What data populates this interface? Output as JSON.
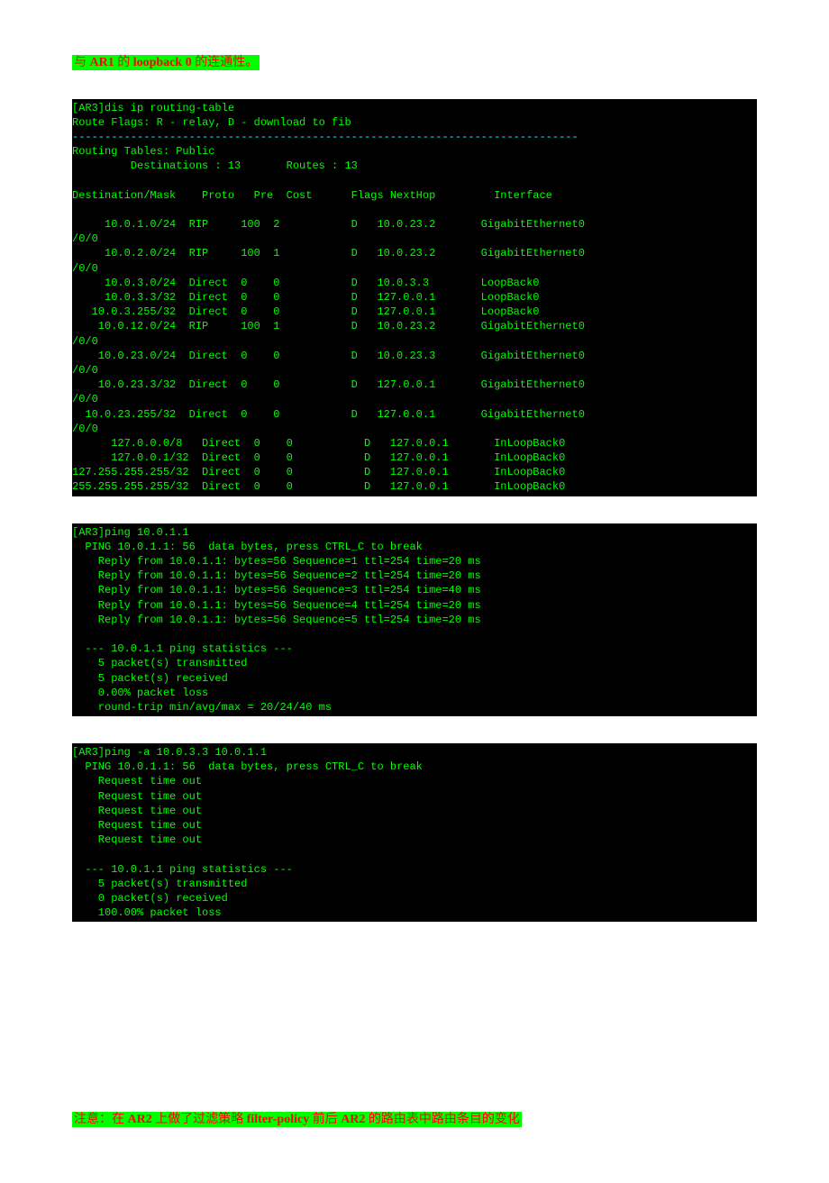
{
  "text1": {
    "pre": "与 ",
    "ar1": "AR1",
    "mid": " 的 ",
    "lb": "loopback 0",
    "post": " 的连通性。"
  },
  "text2": {
    "pre": "注意：在 ",
    "ar2_1": "AR2",
    "mid1": " 上做了过滤策略 ",
    "fp": "filter-policy",
    "mid2": " 前后 ",
    "ar2_2": "AR2",
    "post": " 的路由表中路由条目的变化"
  },
  "term1": {
    "l1": "[AR3]dis ip routing-table",
    "l2": "Route Flags: R - relay, D - download to fib",
    "sep": "------------------------------------------------------------------------------",
    "l3": "Routing Tables: Public",
    "l4": "         Destinations : 13       Routes : 13",
    "hdr": "Destination/Mask    Proto   Pre  Cost      Flags NextHop         Interface",
    "r1a": "     10.0.1.0/24  RIP     100  2           D   10.0.23.2       GigabitEthernet0",
    "slash": "/0/0",
    "r2a": "     10.0.2.0/24  RIP     100  1           D   10.0.23.2       GigabitEthernet0",
    "r3": "     10.0.3.0/24  Direct  0    0           D   10.0.3.3        LoopBack0",
    "r4": "     10.0.3.3/32  Direct  0    0           D   127.0.0.1       LoopBack0",
    "r5": "   10.0.3.255/32  Direct  0    0           D   127.0.0.1       LoopBack0",
    "r6a": "    10.0.12.0/24  RIP     100  1           D   10.0.23.2       GigabitEthernet0",
    "r7a": "    10.0.23.0/24  Direct  0    0           D   10.0.23.3       GigabitEthernet0",
    "r8a": "    10.0.23.3/32  Direct  0    0           D   127.0.0.1       GigabitEthernet0",
    "r9a": "  10.0.23.255/32  Direct  0    0           D   127.0.0.1       GigabitEthernet0",
    "r10": "      127.0.0.0/8   Direct  0    0           D   127.0.0.1       InLoopBack0",
    "r11": "      127.0.0.1/32  Direct  0    0           D   127.0.0.1       InLoopBack0",
    "r12": "127.255.255.255/32  Direct  0    0           D   127.0.0.1       InLoopBack0",
    "r13": "255.255.255.255/32  Direct  0    0           D   127.0.0.1       InLoopBack0"
  },
  "term2": {
    "l1": "[AR3]ping 10.0.1.1",
    "l2": "  PING 10.0.1.1: 56  data bytes, press CTRL_C to break",
    "l3": "    Reply from 10.0.1.1: bytes=56 Sequence=1 ttl=254 time=20 ms",
    "l4": "    Reply from 10.0.1.1: bytes=56 Sequence=2 ttl=254 time=20 ms",
    "l5": "    Reply from 10.0.1.1: bytes=56 Sequence=3 ttl=254 time=40 ms",
    "l6": "    Reply from 10.0.1.1: bytes=56 Sequence=4 ttl=254 time=20 ms",
    "l7": "    Reply from 10.0.1.1: bytes=56 Sequence=5 ttl=254 time=20 ms",
    "l8": "  --- 10.0.1.1 ping statistics ---",
    "l9": "    5 packet(s) transmitted",
    "l10": "    5 packet(s) received",
    "l11": "    0.00% packet loss",
    "l12": "    round-trip min/avg/max = 20/24/40 ms"
  },
  "term3": {
    "l1": "[AR3]ping -a 10.0.3.3 10.0.1.1",
    "l2": "  PING 10.0.1.1: 56  data bytes, press CTRL_C to break",
    "l3": "    Request time out",
    "l4": "    Request time out",
    "l5": "    Request time out",
    "l6": "    Request time out",
    "l7": "    Request time out",
    "l8": "  --- 10.0.1.1 ping statistics ---",
    "l9": "    5 packet(s) transmitted",
    "l10": "    0 packet(s) received",
    "l11": "    100.00% packet loss"
  }
}
